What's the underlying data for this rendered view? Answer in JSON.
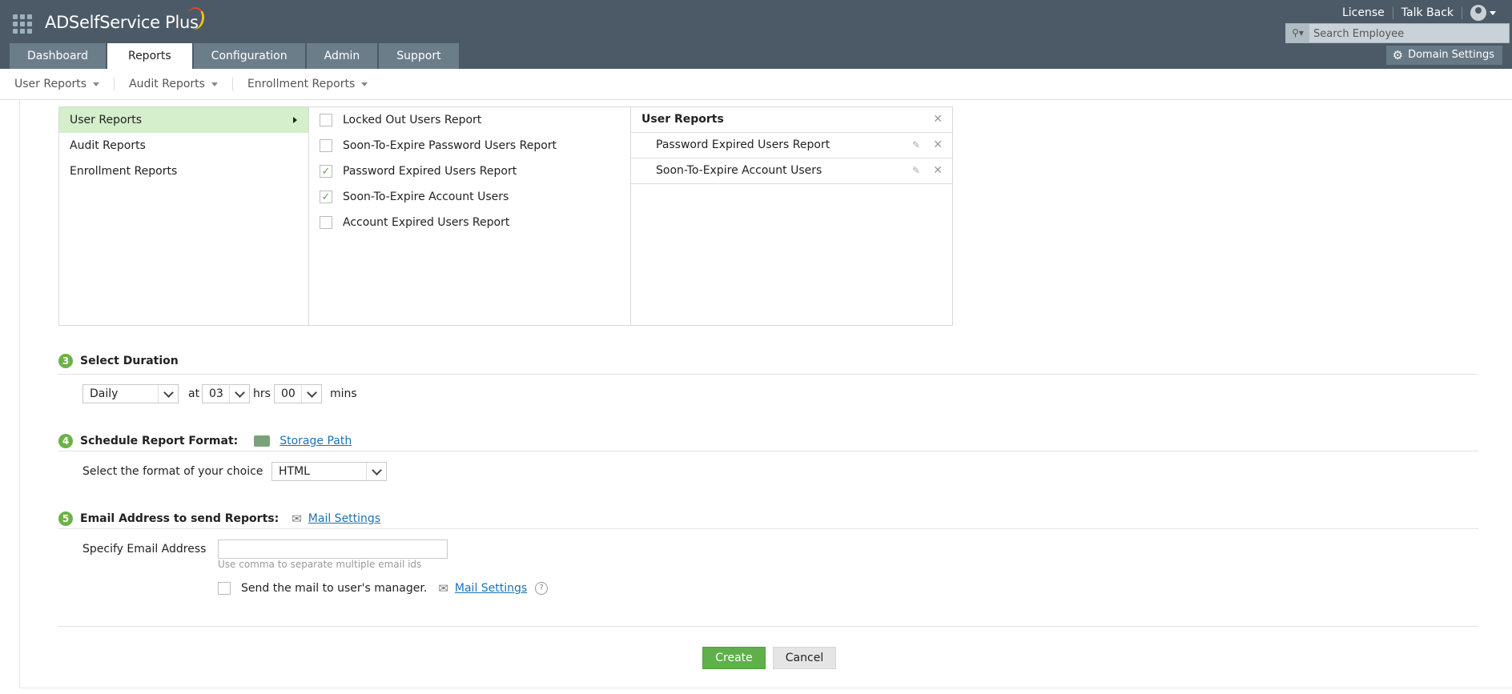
{
  "app": {
    "name": "ADSelfService Plus"
  },
  "top_links": [
    "License",
    "Talk Back"
  ],
  "search": {
    "placeholder": "Search Employee"
  },
  "tabs": [
    {
      "label": "Dashboard",
      "active": false
    },
    {
      "label": "Reports",
      "active": true
    },
    {
      "label": "Configuration",
      "active": false
    },
    {
      "label": "Admin",
      "active": false
    },
    {
      "label": "Support",
      "active": false
    }
  ],
  "domain_settings": "Domain Settings",
  "subnav": [
    "User Reports",
    "Audit Reports",
    "Enrollment Reports"
  ],
  "categories": [
    {
      "label": "User Reports",
      "active": true
    },
    {
      "label": "Audit Reports",
      "active": false
    },
    {
      "label": "Enrollment Reports",
      "active": false
    }
  ],
  "reports": [
    {
      "label": "Locked Out Users Report",
      "checked": false
    },
    {
      "label": "Soon-To-Expire Password Users Report",
      "checked": false
    },
    {
      "label": "Password Expired Users Report",
      "checked": true
    },
    {
      "label": "Soon-To-Expire Account Users",
      "checked": true
    },
    {
      "label": "Account Expired Users Report",
      "checked": false
    }
  ],
  "selected": {
    "title": "User Reports",
    "items": [
      "Password Expired Users Report",
      "Soon-To-Expire Account Users"
    ]
  },
  "duration": {
    "num": "3",
    "title": "Select Duration",
    "frequency": "Daily",
    "at": "at",
    "hours": "03",
    "hrs": "hrs",
    "minutes": "00",
    "mins": "mins"
  },
  "format": {
    "num": "4",
    "title": "Schedule Report Format:",
    "storage_link": "Storage Path",
    "label": "Select the format of your choice",
    "value": "HTML"
  },
  "email": {
    "num": "5",
    "title": "Email Address to send Reports:",
    "mail_link": "Mail Settings",
    "label": "Specify Email Address",
    "value": "",
    "hint": "Use comma to separate multiple email ids",
    "manager_label": "Send the mail to user's manager.",
    "manager_checked": false,
    "manager_mail_link": "Mail Settings"
  },
  "actions": {
    "create": "Create",
    "cancel": "Cancel"
  },
  "colors": {
    "header": "#4b5a66",
    "tab": "#6c7d8a",
    "accent_green": "#6cb246",
    "active_category": "#d5eecb",
    "link": "#1a73b5"
  }
}
